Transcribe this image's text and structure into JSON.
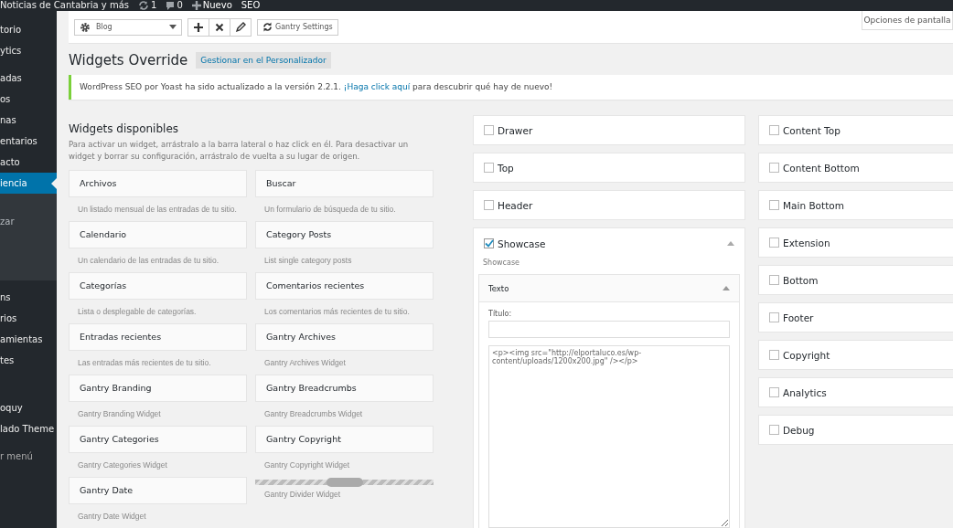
{
  "admin_bar": {
    "site": "Noticias de Cantabria y más",
    "updates": "1",
    "comments": "0",
    "new": "Nuevo",
    "seo": "SEO"
  },
  "sidebar": {
    "groups": [
      [
        {
          "label": "torio",
          "selected": false
        },
        {
          "label": "ytics",
          "selected": false
        }
      ],
      [
        {
          "label": "adas",
          "selected": false
        },
        {
          "label": "os",
          "selected": false
        },
        {
          "label": "nas",
          "selected": false
        },
        {
          "label": "entarios",
          "selected": false
        },
        {
          "label": "acto",
          "selected": false
        },
        {
          "label": "iencia",
          "selected": true,
          "children": [
            {
              "label": "zar",
              "selected": false
            }
          ]
        }
      ],
      [
        {
          "label": "ns",
          "selected": false
        },
        {
          "label": "rios",
          "selected": false
        },
        {
          "label": "amientas",
          "selected": false
        },
        {
          "label": "tes",
          "selected": false
        }
      ],
      [
        {
          "label": "oquy",
          "selected": false
        },
        {
          "label": "lado Theme",
          "selected": false
        }
      ]
    ],
    "collapse": "r menú"
  },
  "toolbar": {
    "layout_select": "Blog",
    "settings_button": "Gantry Settings"
  },
  "screen_options": "Opciones de pantalla",
  "title": "Widgets Override",
  "customize_button": "Gestionar en el Personalizador",
  "notice": {
    "text": "WordPress SEO por Yoast ha sido actualizado a la versión 2.2.1. ",
    "link": "¡Haga click aquí",
    "after": " para descubrir qué hay de nuevo!"
  },
  "available": {
    "title": "Widgets disponibles",
    "description": "Para activar un widget, arrástralo a la barra lateral o haz click en él. Para desactivar un widget y borrar su configuración, arrástralo de vuelta a su lugar de origen.",
    "widgets": [
      {
        "kind": "widget",
        "name": "Archivos",
        "description": "Un listado mensual de las entradas de tu sitio."
      },
      {
        "kind": "widget",
        "name": "Buscar",
        "description": "Un formulario de búsqueda de tu sitio."
      },
      {
        "kind": "widget",
        "name": "Calendario",
        "description": "Un calendario de las entradas de tu sitio."
      },
      {
        "kind": "widget",
        "name": "Category Posts",
        "description": "List single category posts"
      },
      {
        "kind": "widget",
        "name": "Categorías",
        "description": "Lista o desplegable de categorías."
      },
      {
        "kind": "widget",
        "name": "Comentarios recientes",
        "description": "Los comentarios más recientes de tu sitio."
      },
      {
        "kind": "widget",
        "name": "Entradas recientes",
        "description": "Las entradas más recientes de tu sitio."
      },
      {
        "kind": "widget",
        "name": "Gantry Archives",
        "description": "Gantry Archives Widget"
      },
      {
        "kind": "widget",
        "name": "Gantry Branding",
        "description": "Gantry Branding Widget"
      },
      {
        "kind": "widget",
        "name": "Gantry Breadcrumbs",
        "description": "Gantry Breadcrumbs Widget"
      },
      {
        "kind": "widget",
        "name": "Gantry Categories",
        "description": "Gantry Categories Widget"
      },
      {
        "kind": "widget",
        "name": "Gantry Copyright",
        "description": "Gantry Copyright Widget"
      },
      {
        "kind": "widget",
        "name": "Gantry Date",
        "description": "Gantry Date Widget"
      },
      {
        "kind": "divider",
        "description": "Gantry Divider Widget"
      }
    ]
  },
  "sidebars_left": [
    {
      "name": "Drawer",
      "checked": false,
      "expanded": false
    },
    {
      "name": "Top",
      "checked": false,
      "expanded": false
    },
    {
      "name": "Header",
      "checked": false,
      "expanded": false
    },
    {
      "name": "Showcase",
      "checked": true,
      "expanded": true,
      "description": "Showcase",
      "widgets": [
        {
          "name": "Texto",
          "expanded": true,
          "title_label": "Título:",
          "content": "<p><img src=\"http://elportaluco.es/wp-content/uploads/1200x200.jpg\" /></p>"
        }
      ]
    }
  ],
  "sidebars_right": [
    {
      "name": "Content Top",
      "checked": false,
      "expanded": false
    },
    {
      "name": "Content Bottom",
      "checked": false,
      "expanded": false
    },
    {
      "name": "Main Bottom",
      "checked": false,
      "expanded": false
    },
    {
      "name": "Extension",
      "checked": false,
      "expanded": false
    },
    {
      "name": "Bottom",
      "checked": false,
      "expanded": false
    },
    {
      "name": "Footer",
      "checked": false,
      "expanded": false
    },
    {
      "name": "Copyright",
      "checked": false,
      "expanded": false
    },
    {
      "name": "Analytics",
      "checked": false,
      "expanded": false
    },
    {
      "name": "Debug",
      "checked": false,
      "expanded": false
    }
  ]
}
